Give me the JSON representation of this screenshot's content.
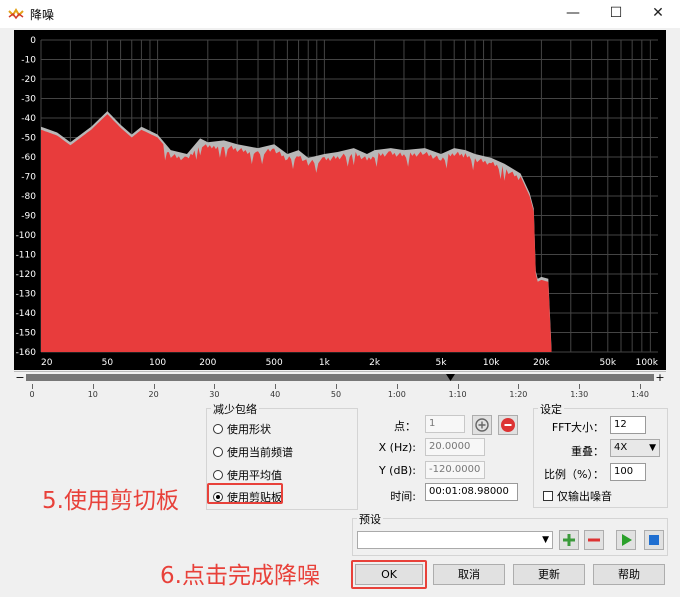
{
  "window": {
    "title": "降噪",
    "minimize": "—",
    "maximize": "☐",
    "close": "✕"
  },
  "chart_data": {
    "type": "area",
    "x_ticks": [
      "20",
      "50",
      "100",
      "200",
      "500",
      "1k",
      "2k",
      "5k",
      "10k",
      "20k",
      "50k",
      "100k"
    ],
    "x_tick_hz": [
      20,
      50,
      100,
      200,
      500,
      1000,
      2000,
      5000,
      10000,
      20000,
      50000,
      100000
    ],
    "y_ticks": [
      "0",
      "-10",
      "-20",
      "-30",
      "-40",
      "-50",
      "-60",
      "-70",
      "-80",
      "-90",
      "-100",
      "-110",
      "-120",
      "-130",
      "-140",
      "-150",
      "-160"
    ],
    "xscale": "log",
    "xlim": [
      20,
      100000
    ],
    "ylim": [
      -160,
      0
    ],
    "grid": true,
    "colors": {
      "fill": "#e83c3c",
      "profile": "#b8b8b8",
      "grid": "#444444",
      "background": "#000000"
    },
    "x": [
      20,
      25,
      30,
      40,
      50,
      60,
      70,
      80,
      100,
      120,
      150,
      180,
      200,
      250,
      300,
      400,
      500,
      600,
      700,
      800,
      1000,
      1200,
      1500,
      1800,
      2000,
      2500,
      3000,
      4000,
      5000,
      6000,
      7000,
      8000,
      10000,
      12000,
      15000,
      17000,
      18000,
      18500,
      19000,
      20000,
      22000,
      23000
    ],
    "y": [
      -46,
      -49,
      -54,
      -46,
      -38,
      -45,
      -50,
      -46,
      -50,
      -58,
      -60,
      -52,
      -54,
      -53,
      -55,
      -57,
      -55,
      -60,
      -58,
      -62,
      -60,
      -59,
      -57,
      -60,
      -58,
      -57,
      -58,
      -57,
      -60,
      -57,
      -58,
      -60,
      -62,
      -65,
      -70,
      -80,
      -88,
      -120,
      -124,
      -123,
      -124,
      -160
    ]
  },
  "timeline": {
    "labels": [
      "0",
      "10",
      "20",
      "30",
      "40",
      "50",
      "1:00",
      "1:10",
      "1:20",
      "1:30",
      "1:40"
    ]
  },
  "envelope": {
    "title": "减少包络",
    "options": [
      "使用形状",
      "使用当前频谱",
      "使用平均值",
      "使用剪贴板"
    ],
    "selected": 3
  },
  "point": {
    "point_label": "点：",
    "point_value": "1",
    "x_label": "X (Hz):",
    "x_value": "20.0000",
    "y_label": "Y (dB):",
    "y_value": "-120.0000",
    "time_label": "时间:",
    "time_value": "00:01:08.98000"
  },
  "settings": {
    "title": "设定",
    "fft_label": "FFT大小：",
    "fft_value": "12",
    "overlap_label": "重叠：",
    "overlap_value": "4X",
    "ratio_label": "比例（%）：",
    "ratio_value": "100",
    "noise_only_label": "仅输出噪音"
  },
  "preset": {
    "title": "预设",
    "value": ""
  },
  "buttons": {
    "ok": "OK",
    "cancel": "取消",
    "update": "更新",
    "help": "帮助"
  },
  "annotations": {
    "step5": "5.使用剪切板",
    "step6": "6.点击完成降噪"
  }
}
